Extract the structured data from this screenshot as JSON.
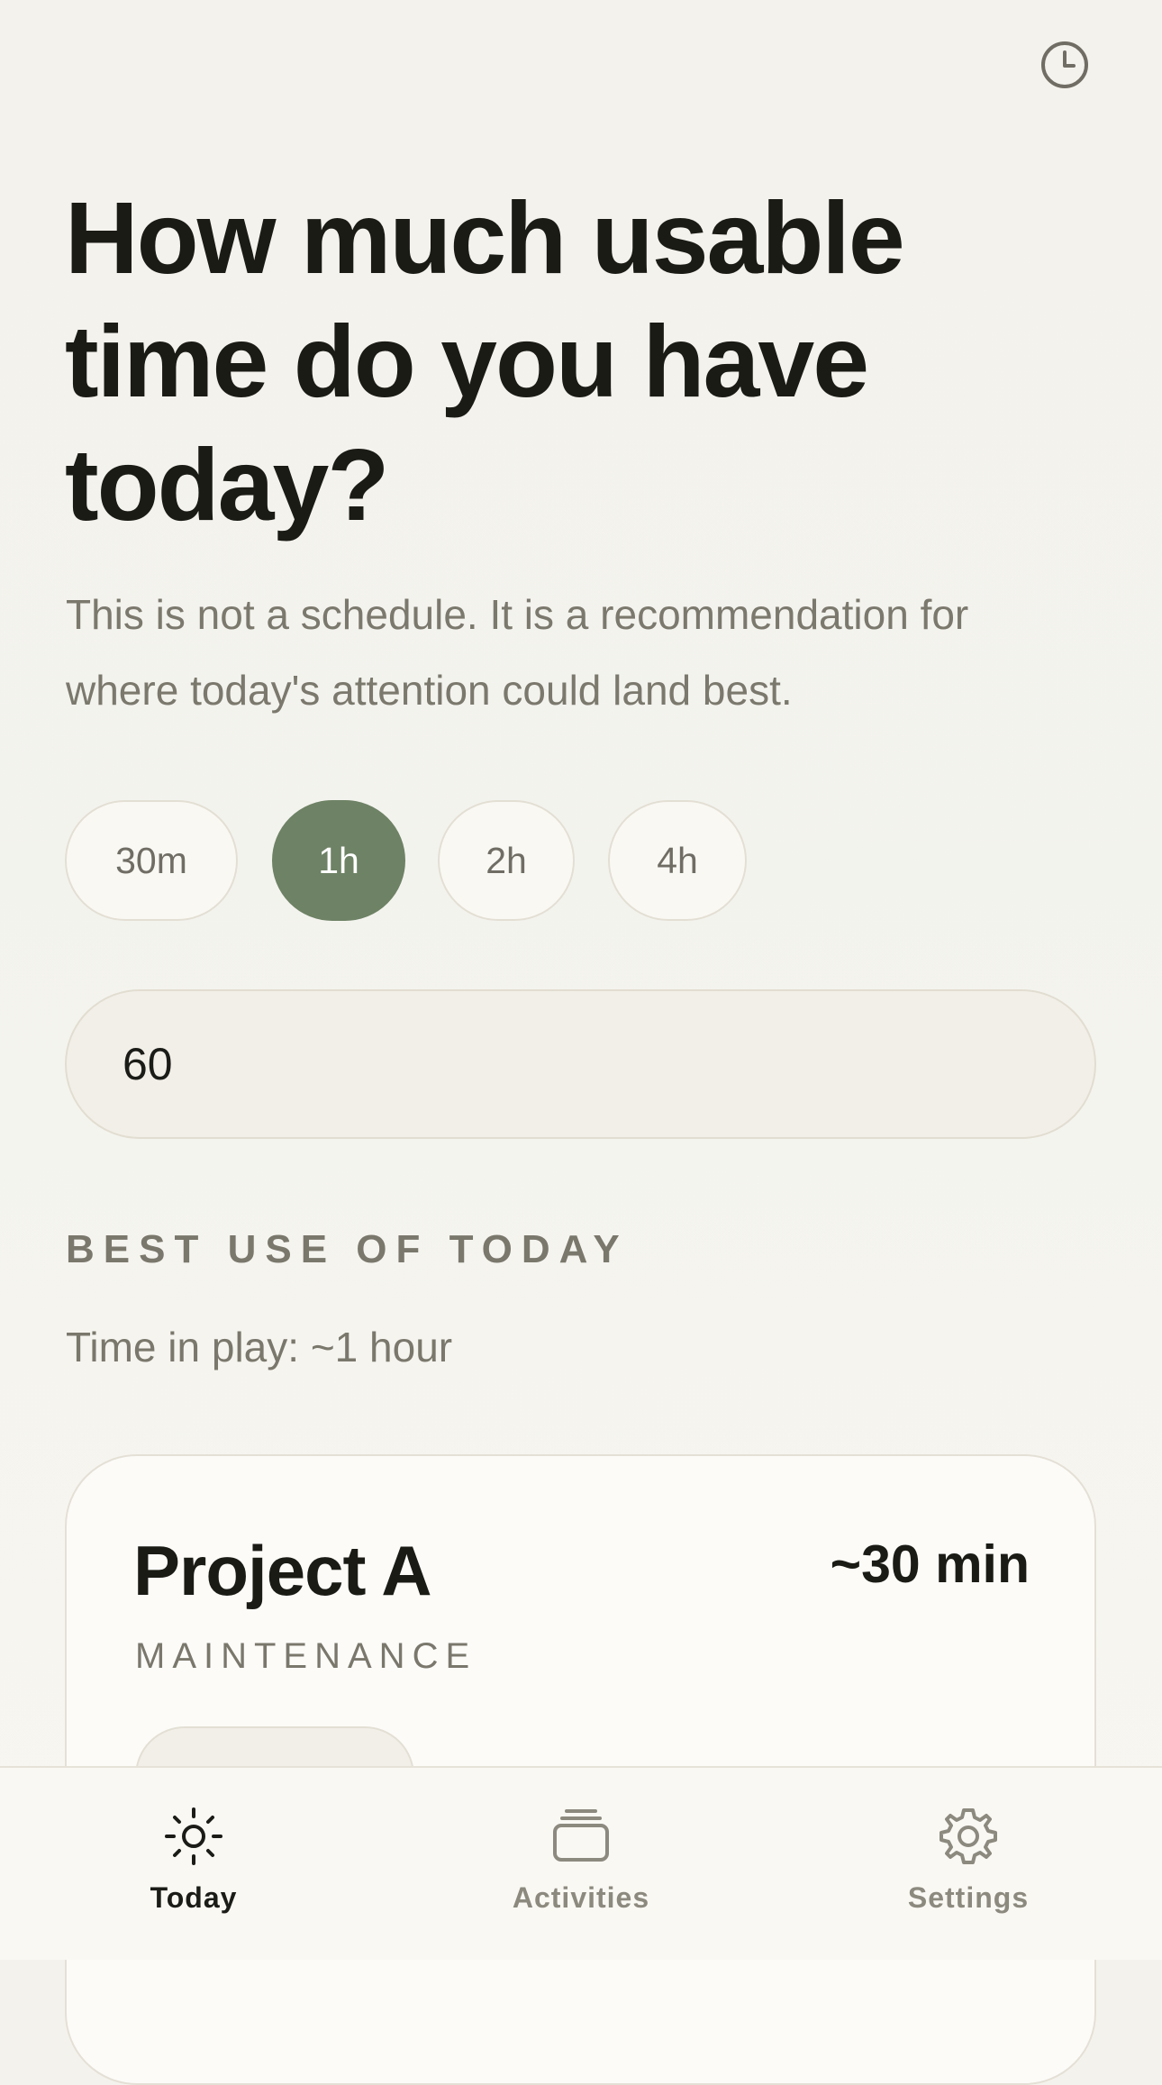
{
  "header": {
    "history_icon": "clock-icon"
  },
  "intro": {
    "headline_line1": "How much usable",
    "headline_line2": "time do you have",
    "headline_line3": "today?",
    "subtitle_line1": "This is not a schedule. It is a recommendation for",
    "subtitle_line2": "where today's attention could land best."
  },
  "time_options": {
    "options": [
      {
        "label": "30m",
        "selected": false
      },
      {
        "label": "1h",
        "selected": true
      },
      {
        "label": "2h",
        "selected": false
      },
      {
        "label": "4h",
        "selected": false
      }
    ],
    "selected_color": "#6e8265"
  },
  "minutes_input": {
    "value": "60"
  },
  "best_use": {
    "section_label": "BEST USE OF TODAY",
    "time_in_play": "Time in play: ~1 hour",
    "cards": [
      {
        "title": "Project A",
        "duration": "~30 min",
        "category": "MAINTENANCE"
      }
    ]
  },
  "tab_bar": {
    "tabs": [
      {
        "label": "Today",
        "icon": "sun-icon",
        "active": true
      },
      {
        "label": "Activities",
        "icon": "stack-icon",
        "active": false
      },
      {
        "label": "Settings",
        "icon": "gear-icon",
        "active": false
      }
    ]
  }
}
